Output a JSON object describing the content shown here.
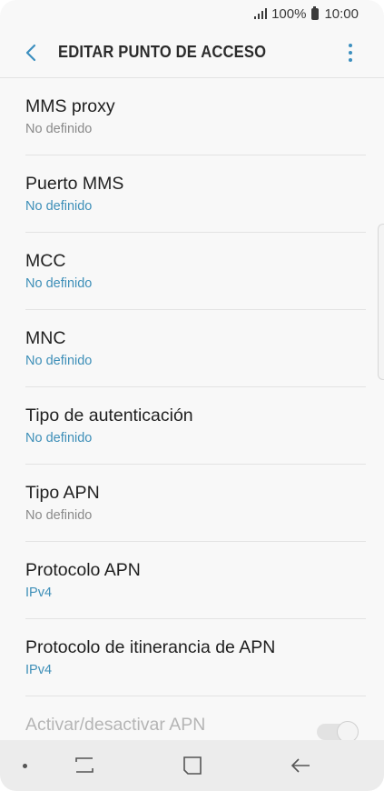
{
  "status_bar": {
    "battery": "100%",
    "time": "10:00"
  },
  "app_bar": {
    "title": "EDITAR PUNTO DE ACCESO"
  },
  "items": [
    {
      "title": "MMS proxy",
      "value": "No definido",
      "value_style": "muted"
    },
    {
      "title": "Puerto MMS",
      "value": "No definido",
      "value_style": "accent"
    },
    {
      "title": "MCC",
      "value": "No definido",
      "value_style": "accent"
    },
    {
      "title": "MNC",
      "value": "No definido",
      "value_style": "accent"
    },
    {
      "title": "Tipo de autenticación",
      "value": "No definido",
      "value_style": "accent"
    },
    {
      "title": "Tipo APN",
      "value": "No definido",
      "value_style": "muted"
    },
    {
      "title": "Protocolo APN",
      "value": "IPv4",
      "value_style": "accent"
    },
    {
      "title": "Protocolo de itinerancia de APN",
      "value": "IPv4",
      "value_style": "accent"
    },
    {
      "title": "Activar/desactivar APN",
      "value": "",
      "value_style": "disabled"
    }
  ],
  "colors": {
    "accent": "#3e8fb8",
    "muted": "#8a8a8a",
    "nav_bar": "#ececec"
  },
  "icons": {
    "back": "back-arrow-icon",
    "more": "more-vert-icon",
    "nav_recents": "recents-icon",
    "nav_home": "home-icon",
    "nav_back": "nav-back-icon"
  }
}
